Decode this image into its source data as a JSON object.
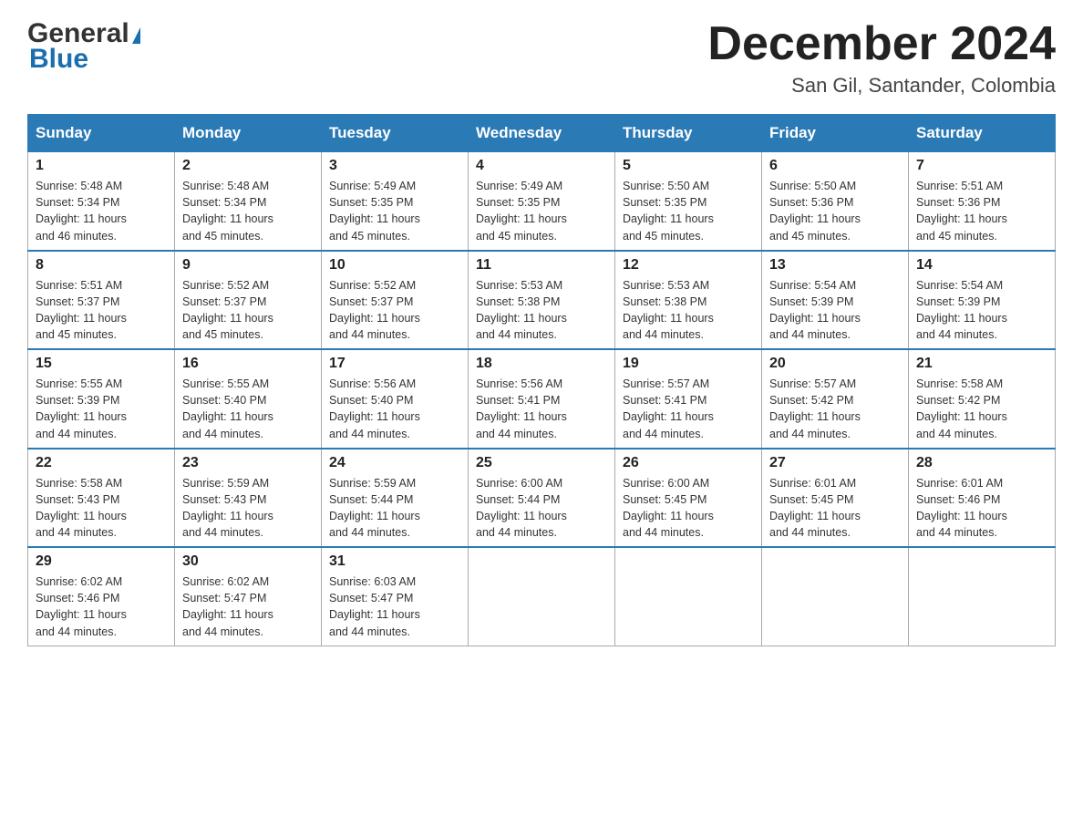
{
  "header": {
    "logo_general": "General",
    "logo_blue": "Blue",
    "month_title": "December 2024",
    "location": "San Gil, Santander, Colombia"
  },
  "days_of_week": [
    "Sunday",
    "Monday",
    "Tuesday",
    "Wednesday",
    "Thursday",
    "Friday",
    "Saturday"
  ],
  "weeks": [
    [
      {
        "day": "1",
        "sunrise": "5:48 AM",
        "sunset": "5:34 PM",
        "daylight": "11 hours and 46 minutes."
      },
      {
        "day": "2",
        "sunrise": "5:48 AM",
        "sunset": "5:34 PM",
        "daylight": "11 hours and 45 minutes."
      },
      {
        "day": "3",
        "sunrise": "5:49 AM",
        "sunset": "5:35 PM",
        "daylight": "11 hours and 45 minutes."
      },
      {
        "day": "4",
        "sunrise": "5:49 AM",
        "sunset": "5:35 PM",
        "daylight": "11 hours and 45 minutes."
      },
      {
        "day": "5",
        "sunrise": "5:50 AM",
        "sunset": "5:35 PM",
        "daylight": "11 hours and 45 minutes."
      },
      {
        "day": "6",
        "sunrise": "5:50 AM",
        "sunset": "5:36 PM",
        "daylight": "11 hours and 45 minutes."
      },
      {
        "day": "7",
        "sunrise": "5:51 AM",
        "sunset": "5:36 PM",
        "daylight": "11 hours and 45 minutes."
      }
    ],
    [
      {
        "day": "8",
        "sunrise": "5:51 AM",
        "sunset": "5:37 PM",
        "daylight": "11 hours and 45 minutes."
      },
      {
        "day": "9",
        "sunrise": "5:52 AM",
        "sunset": "5:37 PM",
        "daylight": "11 hours and 45 minutes."
      },
      {
        "day": "10",
        "sunrise": "5:52 AM",
        "sunset": "5:37 PM",
        "daylight": "11 hours and 44 minutes."
      },
      {
        "day": "11",
        "sunrise": "5:53 AM",
        "sunset": "5:38 PM",
        "daylight": "11 hours and 44 minutes."
      },
      {
        "day": "12",
        "sunrise": "5:53 AM",
        "sunset": "5:38 PM",
        "daylight": "11 hours and 44 minutes."
      },
      {
        "day": "13",
        "sunrise": "5:54 AM",
        "sunset": "5:39 PM",
        "daylight": "11 hours and 44 minutes."
      },
      {
        "day": "14",
        "sunrise": "5:54 AM",
        "sunset": "5:39 PM",
        "daylight": "11 hours and 44 minutes."
      }
    ],
    [
      {
        "day": "15",
        "sunrise": "5:55 AM",
        "sunset": "5:39 PM",
        "daylight": "11 hours and 44 minutes."
      },
      {
        "day": "16",
        "sunrise": "5:55 AM",
        "sunset": "5:40 PM",
        "daylight": "11 hours and 44 minutes."
      },
      {
        "day": "17",
        "sunrise": "5:56 AM",
        "sunset": "5:40 PM",
        "daylight": "11 hours and 44 minutes."
      },
      {
        "day": "18",
        "sunrise": "5:56 AM",
        "sunset": "5:41 PM",
        "daylight": "11 hours and 44 minutes."
      },
      {
        "day": "19",
        "sunrise": "5:57 AM",
        "sunset": "5:41 PM",
        "daylight": "11 hours and 44 minutes."
      },
      {
        "day": "20",
        "sunrise": "5:57 AM",
        "sunset": "5:42 PM",
        "daylight": "11 hours and 44 minutes."
      },
      {
        "day": "21",
        "sunrise": "5:58 AM",
        "sunset": "5:42 PM",
        "daylight": "11 hours and 44 minutes."
      }
    ],
    [
      {
        "day": "22",
        "sunrise": "5:58 AM",
        "sunset": "5:43 PM",
        "daylight": "11 hours and 44 minutes."
      },
      {
        "day": "23",
        "sunrise": "5:59 AM",
        "sunset": "5:43 PM",
        "daylight": "11 hours and 44 minutes."
      },
      {
        "day": "24",
        "sunrise": "5:59 AM",
        "sunset": "5:44 PM",
        "daylight": "11 hours and 44 minutes."
      },
      {
        "day": "25",
        "sunrise": "6:00 AM",
        "sunset": "5:44 PM",
        "daylight": "11 hours and 44 minutes."
      },
      {
        "day": "26",
        "sunrise": "6:00 AM",
        "sunset": "5:45 PM",
        "daylight": "11 hours and 44 minutes."
      },
      {
        "day": "27",
        "sunrise": "6:01 AM",
        "sunset": "5:45 PM",
        "daylight": "11 hours and 44 minutes."
      },
      {
        "day": "28",
        "sunrise": "6:01 AM",
        "sunset": "5:46 PM",
        "daylight": "11 hours and 44 minutes."
      }
    ],
    [
      {
        "day": "29",
        "sunrise": "6:02 AM",
        "sunset": "5:46 PM",
        "daylight": "11 hours and 44 minutes."
      },
      {
        "day": "30",
        "sunrise": "6:02 AM",
        "sunset": "5:47 PM",
        "daylight": "11 hours and 44 minutes."
      },
      {
        "day": "31",
        "sunrise": "6:03 AM",
        "sunset": "5:47 PM",
        "daylight": "11 hours and 44 minutes."
      },
      {
        "day": "",
        "sunrise": "",
        "sunset": "",
        "daylight": ""
      },
      {
        "day": "",
        "sunrise": "",
        "sunset": "",
        "daylight": ""
      },
      {
        "day": "",
        "sunrise": "",
        "sunset": "",
        "daylight": ""
      },
      {
        "day": "",
        "sunrise": "",
        "sunset": "",
        "daylight": ""
      }
    ]
  ],
  "labels": {
    "sunrise": "Sunrise:",
    "sunset": "Sunset:",
    "daylight": "Daylight:"
  }
}
